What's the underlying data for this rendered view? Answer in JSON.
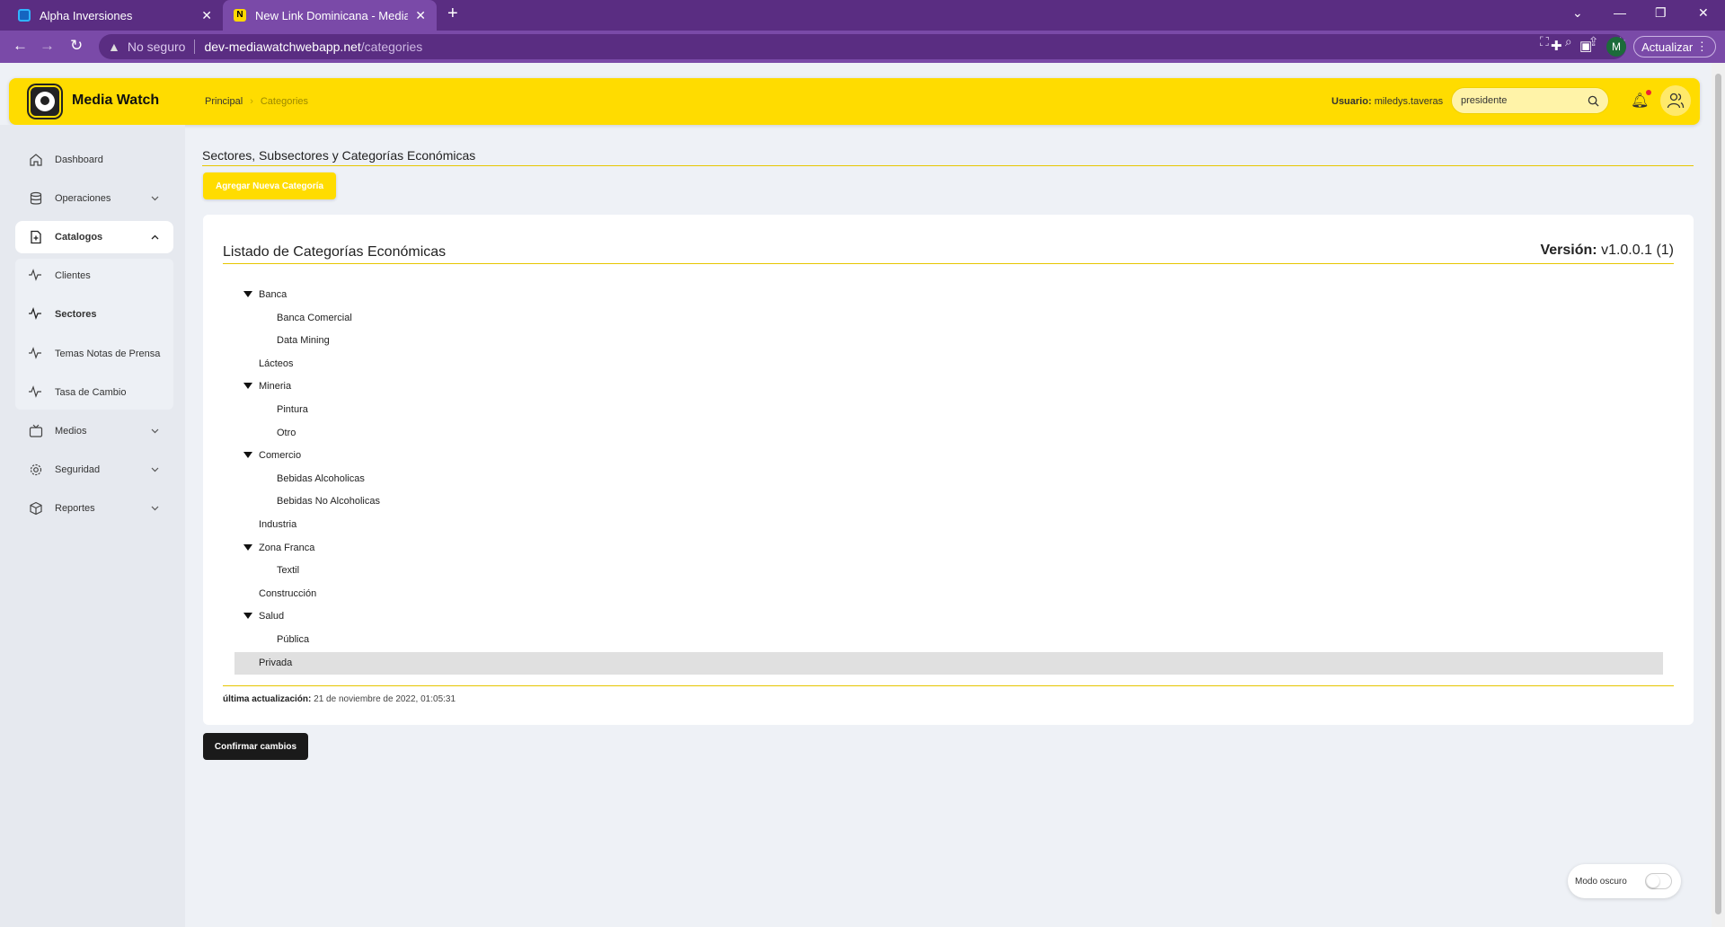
{
  "browser": {
    "tabs": [
      {
        "title": "Alpha Inversiones"
      },
      {
        "title": "New Link Dominicana - Media W",
        "favicon_letter": "N"
      }
    ],
    "address": {
      "security": "No seguro",
      "host": "dev-mediawatchwebapp.net",
      "path": "/categories"
    },
    "profile_initial": "M",
    "update_label": "Actualizar"
  },
  "header": {
    "brand": "Media Watch",
    "breadcrumb": {
      "home": "Principal",
      "current": "Categories"
    },
    "user_label": "Usuario:",
    "user_name": "miledys.taveras",
    "search_value": "presidente"
  },
  "sidebar": {
    "items": [
      {
        "label": "Dashboard",
        "icon": "home-icon"
      },
      {
        "label": "Operaciones",
        "icon": "database-icon"
      },
      {
        "label": "Catalogos",
        "icon": "file-plus-icon"
      },
      {
        "label": "Medios",
        "icon": "tv-icon"
      },
      {
        "label": "Seguridad",
        "icon": "gear-icon"
      },
      {
        "label": "Reportes",
        "icon": "box-icon"
      }
    ],
    "catalog_subitems": [
      {
        "label": "Clientes",
        "icon": "activity-icon"
      },
      {
        "label": "Sectores",
        "icon": "activity-icon"
      },
      {
        "label": "Temas Notas de Prensa",
        "icon": "activity-icon"
      },
      {
        "label": "Tasa de Cambio",
        "icon": "activity-icon"
      }
    ]
  },
  "main": {
    "page_title": "Sectores, Subsectores y Categorías Económicas",
    "add_button": "Agregar Nueva Categoría",
    "card_title": "Listado de Categorías Económicas",
    "version_label": "Versión:",
    "version_value": "v1.0.0.1 (1)",
    "tree": [
      {
        "label": "Banca",
        "level": 0,
        "expanded": true
      },
      {
        "label": "Banca Comercial",
        "level": 1
      },
      {
        "label": "Data Mining",
        "level": 1
      },
      {
        "label": "Lácteos",
        "level": 0
      },
      {
        "label": "Mineria",
        "level": 0,
        "expanded": true
      },
      {
        "label": "Pintura",
        "level": 1
      },
      {
        "label": "Otro",
        "level": 1
      },
      {
        "label": "Comercio",
        "level": 0,
        "expanded": true
      },
      {
        "label": "Bebidas Alcoholicas",
        "level": 1
      },
      {
        "label": "Bebidas No Alcoholicas",
        "level": 1
      },
      {
        "label": "Industria",
        "level": 0
      },
      {
        "label": "Zona Franca",
        "level": 0,
        "expanded": true
      },
      {
        "label": "Textil",
        "level": 1
      },
      {
        "label": "Construcción",
        "level": 0
      },
      {
        "label": "Salud",
        "level": 0,
        "expanded": true
      },
      {
        "label": "Pública",
        "level": 1
      },
      {
        "label": "Privada",
        "level": 0,
        "selected": true
      }
    ],
    "updated_label": "última actualización:",
    "updated_value": "21 de noviembre de 2022, 01:05:31",
    "confirm_button": "Confirmar cambios",
    "dark_mode_label": "Modo oscuro"
  },
  "colors": {
    "brand_yellow": "#ffdc00",
    "browser_purple": "#5a2d82",
    "button_dark": "#1a1a1a"
  }
}
